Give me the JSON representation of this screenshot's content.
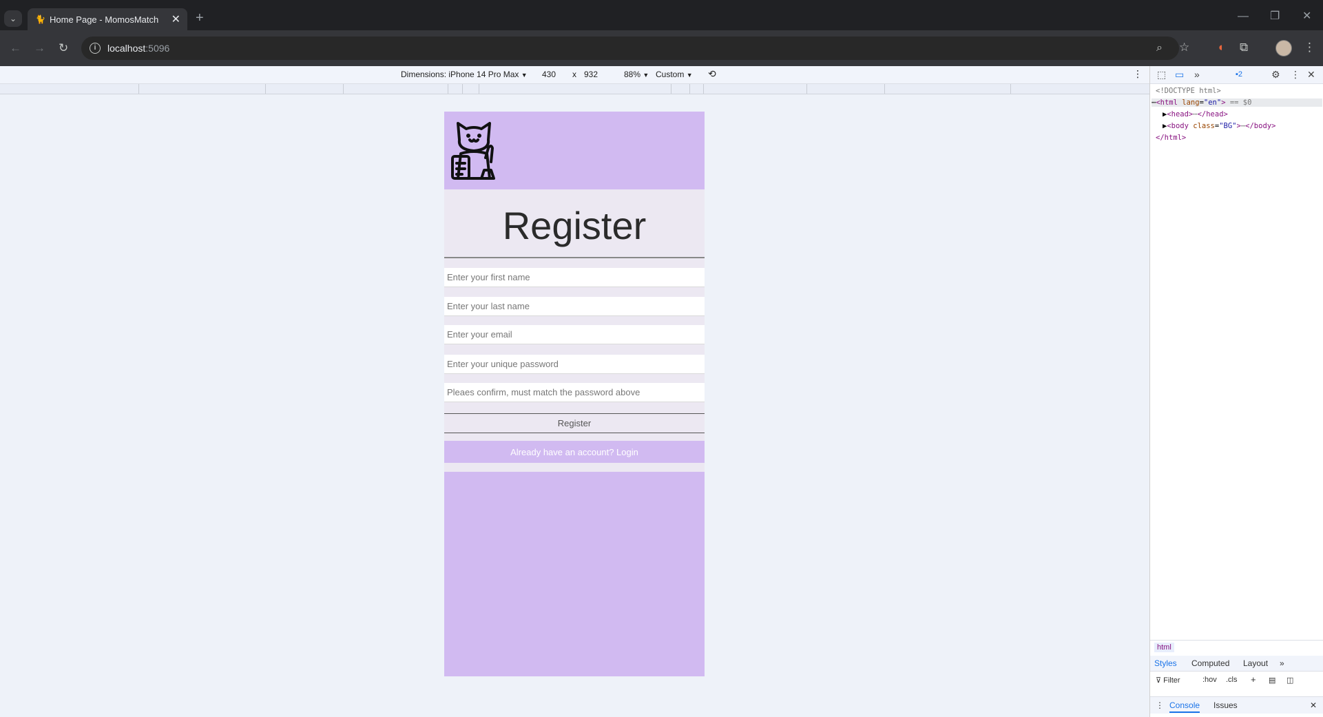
{
  "browser": {
    "tab_title": "Home Page - MomosMatch",
    "tab_close": "✕",
    "new_tab": "+",
    "url_host": "localhost",
    "url_port": ":5096",
    "window_controls": {
      "minimize": "—",
      "restore": "❐",
      "close": "✕"
    },
    "nav": {
      "back": "←",
      "forward": "→",
      "reload": "↻"
    },
    "toolbar_icons": [
      "zoom-icon",
      "star-icon",
      "extension-icon",
      "puzzle-icon",
      "menu-icon"
    ]
  },
  "device_toolbar": {
    "dimensions_label": "Dimensions: iPhone 14 Pro Max",
    "width": "430",
    "times": "x",
    "height": "932",
    "zoom": "88%",
    "throttle": "Custom"
  },
  "page": {
    "title": "Register",
    "fields": {
      "first_name_placeholder": "Enter your first name",
      "last_name_placeholder": "Enter your last name",
      "email_placeholder": "Enter your email",
      "password_placeholder": "Enter your unique password",
      "confirm_placeholder": "Pleaes confirm, must match the password above"
    },
    "register_button": "Register",
    "login_button": "Already have an account? Login",
    "colors": {
      "lavender": "#d1baf1",
      "panel": "#ece8f2"
    }
  },
  "devtools": {
    "issues_count": "2",
    "dom": {
      "doctype": "<!DOCTYPE html>",
      "html_open_tag": "<html",
      "html_lang_attr": "lang",
      "html_lang_val": "\"en\"",
      "html_close_bracket": ">",
      "selected_marker": "== $0",
      "head_line": "<head>",
      "head_dots": "⋯",
      "head_close": "</head>",
      "body_open": "<body",
      "body_class_attr": "class",
      "body_class_val": "\"BG\"",
      "body_close": "</body>",
      "html_close": "</html>"
    },
    "breadcrumb": "html",
    "styles_tabs": [
      "Styles",
      "Computed",
      "Layout"
    ],
    "filter_label": "Filter",
    "hov_label": ":hov",
    "cls_label": ".cls",
    "drawer_tabs": [
      "Console",
      "Issues"
    ]
  }
}
